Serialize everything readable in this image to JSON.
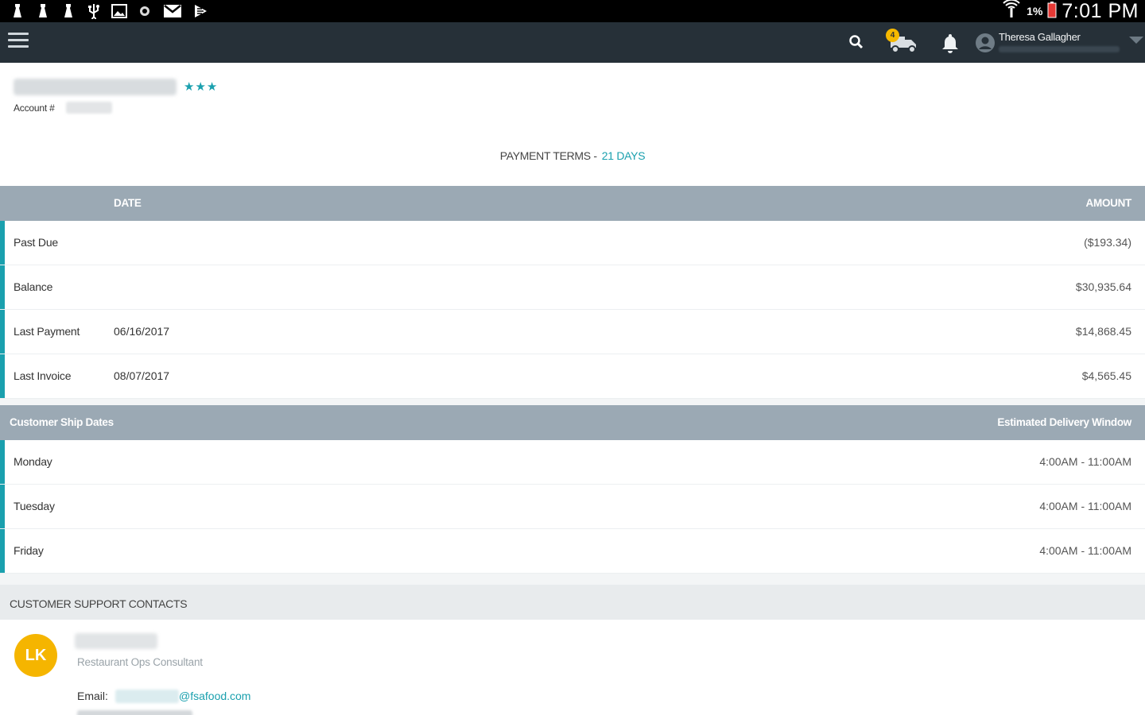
{
  "status_bar": {
    "icons": [
      "notification-icon",
      "notification-icon",
      "notification-icon",
      "usb-icon",
      "image-icon",
      "dot-icon",
      "gmail-icon",
      "play-store-icon"
    ],
    "signal_icon": "signal-icon",
    "battery_percent": "1%",
    "battery_color": "#e53935",
    "time": "7:01 PM"
  },
  "app_bar": {
    "menu_icon": "hamburger-menu-icon",
    "search_icon": "search-icon",
    "delivery_icon": "truck-icon",
    "delivery_badge": "4",
    "notification_icon": "bell-icon",
    "user_icon": "account-circle-icon",
    "user_name": "Theresa Gallagher",
    "background": "#263038"
  },
  "account": {
    "rating": "★★★",
    "account_label": "Account #"
  },
  "payment_terms": {
    "label": "PAYMENT TERMS -",
    "value": "21 DAYS"
  },
  "balance_table": {
    "header_date": "DATE",
    "header_amount": "AMOUNT",
    "rows": [
      {
        "label": "Past Due",
        "date": "",
        "amount": "($193.34)"
      },
      {
        "label": "Balance",
        "date": "",
        "amount": "$30,935.64"
      },
      {
        "label": "Last Payment",
        "date": "06/16/2017",
        "amount": "$14,868.45"
      },
      {
        "label": "Last Invoice",
        "date": "08/07/2017",
        "amount": "$4,565.45"
      }
    ]
  },
  "ship_table": {
    "header_left": "Customer Ship Dates",
    "header_right": "Estimated Delivery Window",
    "rows": [
      {
        "day": "Monday",
        "window": "4:00AM - 11:00AM"
      },
      {
        "day": "Tuesday",
        "window": "4:00AM - 11:00AM"
      },
      {
        "day": "Friday",
        "window": "4:00AM - 11:00AM"
      }
    ]
  },
  "support": {
    "heading": "CUSTOMER SUPPORT CONTACTS",
    "contacts": [
      {
        "initials": "LK",
        "role": "Restaurant Ops Consultant",
        "email_label": "Email:",
        "email_domain": "@fsafood.com"
      }
    ]
  },
  "colors": {
    "accent": "#1aa0ae",
    "table_header": "#9ba9b4",
    "avatar": "#f5b500"
  }
}
